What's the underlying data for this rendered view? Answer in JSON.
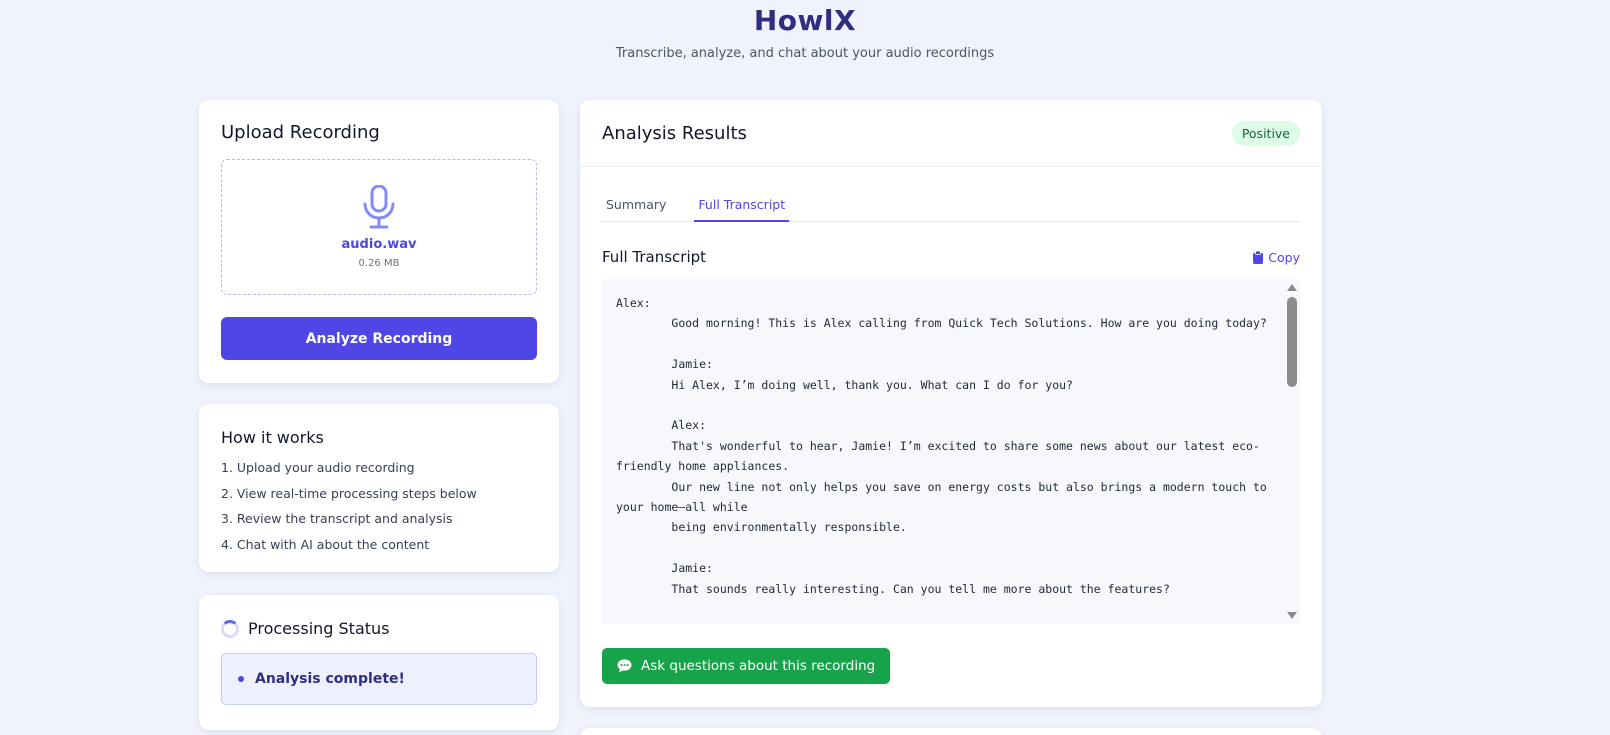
{
  "app": {
    "title": "HowlX",
    "subtitle": "Transcribe, analyze, and chat about your audio recordings"
  },
  "upload": {
    "title": "Upload Recording",
    "file_name": "audio.wav",
    "file_size": "0.26 MB",
    "analyze_label": "Analyze Recording",
    "mic_icon": "microphone-icon"
  },
  "how_it_works": {
    "title": "How it works",
    "steps": [
      "1. Upload your audio recording",
      "2. View real-time processing steps below",
      "3. Review the transcript and analysis",
      "4. Chat with AI about the content"
    ]
  },
  "processing": {
    "title": "Processing Status",
    "message": "Analysis complete!"
  },
  "results": {
    "title": "Analysis Results",
    "sentiment": "Positive",
    "tabs": [
      {
        "label": "Summary",
        "active": false
      },
      {
        "label": "Full Transcript",
        "active": true
      }
    ],
    "transcript_title": "Full Transcript",
    "copy_label": "Copy",
    "transcript": "Alex:\n        Good morning! This is Alex calling from Quick Tech Solutions. How are you doing today?\n\n        Jamie:\n        Hi Alex, I’m doing well, thank you. What can I do for you?\n\n        Alex:\n        That's wonderful to hear, Jamie! I’m excited to share some news about our latest eco-friendly home appliances.\n        Our new line not only helps you save on energy costs but also brings a modern touch to your home—all while\n        being environmentally responsible.\n\n        Jamie:\n        That sounds really interesting. Can you tell me more about the features?",
    "chat_label": "Ask questions about this recording"
  },
  "colors": {
    "accent": "#4f46e5",
    "title": "#312e81",
    "success": "#16a34a",
    "badge_bg": "#dcfce7",
    "background": "#f0f2fc"
  }
}
